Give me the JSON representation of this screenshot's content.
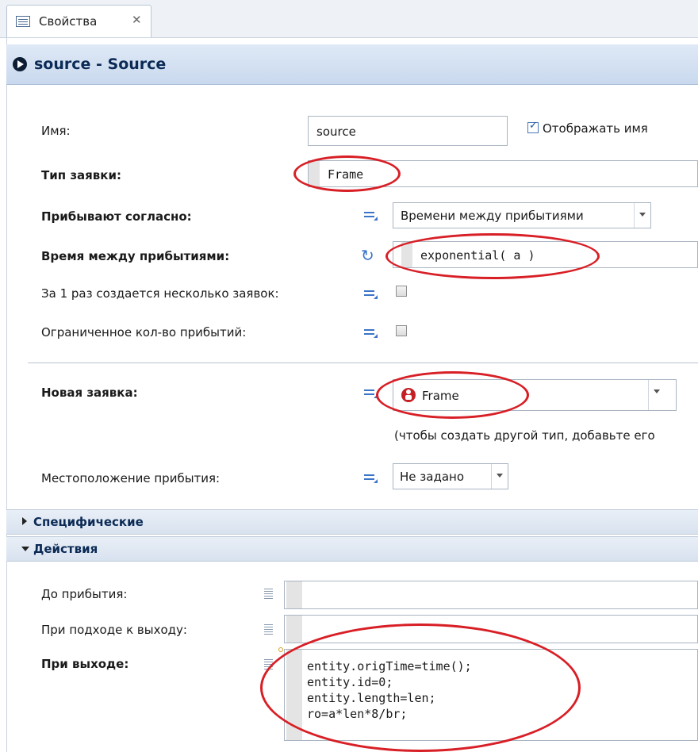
{
  "tab": {
    "label": "Свойства",
    "close": "✕"
  },
  "header": {
    "title": "source - Source"
  },
  "fields": {
    "name_label": "Имя:",
    "name_value": "source",
    "show_name_label": "Отображать имя",
    "show_name_checked": true,
    "agent_type_label": "Тип заявки:",
    "agent_type_value": "Frame",
    "arrive_label": "Прибывают согласно:",
    "arrive_value": "Времени между прибытиями",
    "interarrival_label": "Время между прибытиями:",
    "interarrival_value": "exponential( a )",
    "multiple_label": "За 1 раз создается несколько заявок:",
    "limited_label": "Ограниченное кол-во прибытий:",
    "new_agent_label": "Новая заявка:",
    "new_agent_value": "Frame",
    "new_agent_hint": "(чтобы создать другой тип, добавьте его",
    "location_label": "Местоположение прибытия:",
    "location_value": "Не задано"
  },
  "sections": {
    "specific": "Специфические",
    "actions": "Действия"
  },
  "actions": {
    "before_arrival_label": "До прибытия:",
    "at_exit_approach_label": "При подходе к выходу:",
    "on_exit_label": "При выходе:",
    "on_exit_code": [
      "entity.origTime=time();",
      "entity.id=0;",
      "entity.length=len;",
      "ro=a*len*8/br;"
    ]
  },
  "colors": {
    "annotation": "#d81f26",
    "accent": "#3c74c8",
    "header": "#0b2a55"
  }
}
